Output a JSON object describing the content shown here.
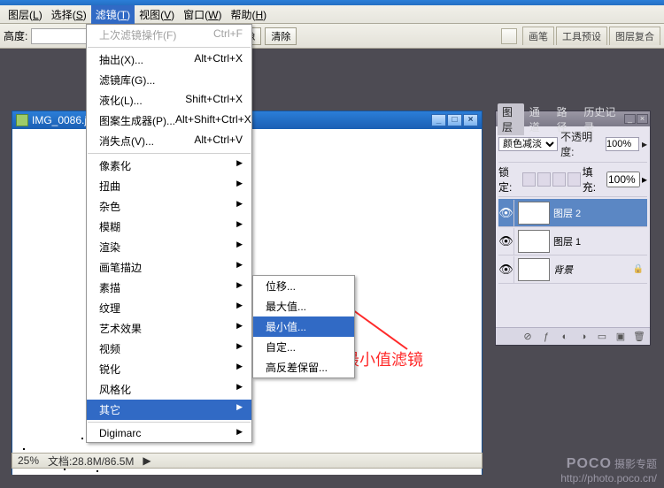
{
  "menubar": {
    "items": [
      {
        "label": "图层",
        "accel": "L"
      },
      {
        "label": "选择",
        "accel": "S"
      },
      {
        "label": "滤镜",
        "accel": "T"
      },
      {
        "label": "视图",
        "accel": "V"
      },
      {
        "label": "窗口",
        "accel": "W"
      },
      {
        "label": "帮助",
        "accel": "H"
      }
    ]
  },
  "toolbar": {
    "height_label": "高度:",
    "height_value": "",
    "btn1": "面的图像",
    "btn2": "清除",
    "tabs": [
      "画笔",
      "工具预设",
      "图层复合"
    ]
  },
  "filter_menu": {
    "last": {
      "label": "上次滤镜操作(F)",
      "shortcut": "Ctrl+F"
    },
    "group1": [
      {
        "label": "抽出(X)...",
        "shortcut": "Alt+Ctrl+X"
      },
      {
        "label": "滤镜库(G)...",
        "shortcut": ""
      },
      {
        "label": "液化(L)...",
        "shortcut": "Shift+Ctrl+X"
      },
      {
        "label": "图案生成器(P)...",
        "shortcut": "Alt+Shift+Ctrl+X"
      },
      {
        "label": "消失点(V)...",
        "shortcut": "Alt+Ctrl+V"
      }
    ],
    "group2": [
      {
        "label": "像素化"
      },
      {
        "label": "扭曲"
      },
      {
        "label": "杂色"
      },
      {
        "label": "模糊"
      },
      {
        "label": "渲染"
      },
      {
        "label": "画笔描边"
      },
      {
        "label": "素描"
      },
      {
        "label": "纹理"
      },
      {
        "label": "艺术效果"
      },
      {
        "label": "视频"
      },
      {
        "label": "锐化"
      },
      {
        "label": "风格化"
      },
      {
        "label": "其它"
      }
    ],
    "digimarc": "Digimarc"
  },
  "submenu_other": [
    {
      "label": "位移..."
    },
    {
      "label": "最大值..."
    },
    {
      "label": "最小值..."
    },
    {
      "label": "自定..."
    },
    {
      "label": "高反差保留..."
    }
  ],
  "document": {
    "title": "IMG_0086.j"
  },
  "layers_panel": {
    "tabs": [
      "图层",
      "通道",
      "路径",
      "历史记录"
    ],
    "blend_mode": "颜色减淡",
    "opacity_label": "不透明度:",
    "opacity_value": "100%",
    "lock_label": "锁定:",
    "fill_label": "填充:",
    "fill_value": "100%",
    "layers": [
      {
        "name": "图层 2"
      },
      {
        "name": "图层 1"
      },
      {
        "name": "背景",
        "locked": true
      }
    ]
  },
  "status": {
    "zoom": "25%",
    "doc": "文档:28.8M/86.5M"
  },
  "annotation": "最小值滤镜",
  "watermark": {
    "brand": "POCO",
    "text": "摄影专题",
    "url": "http://photo.poco.cn/"
  }
}
